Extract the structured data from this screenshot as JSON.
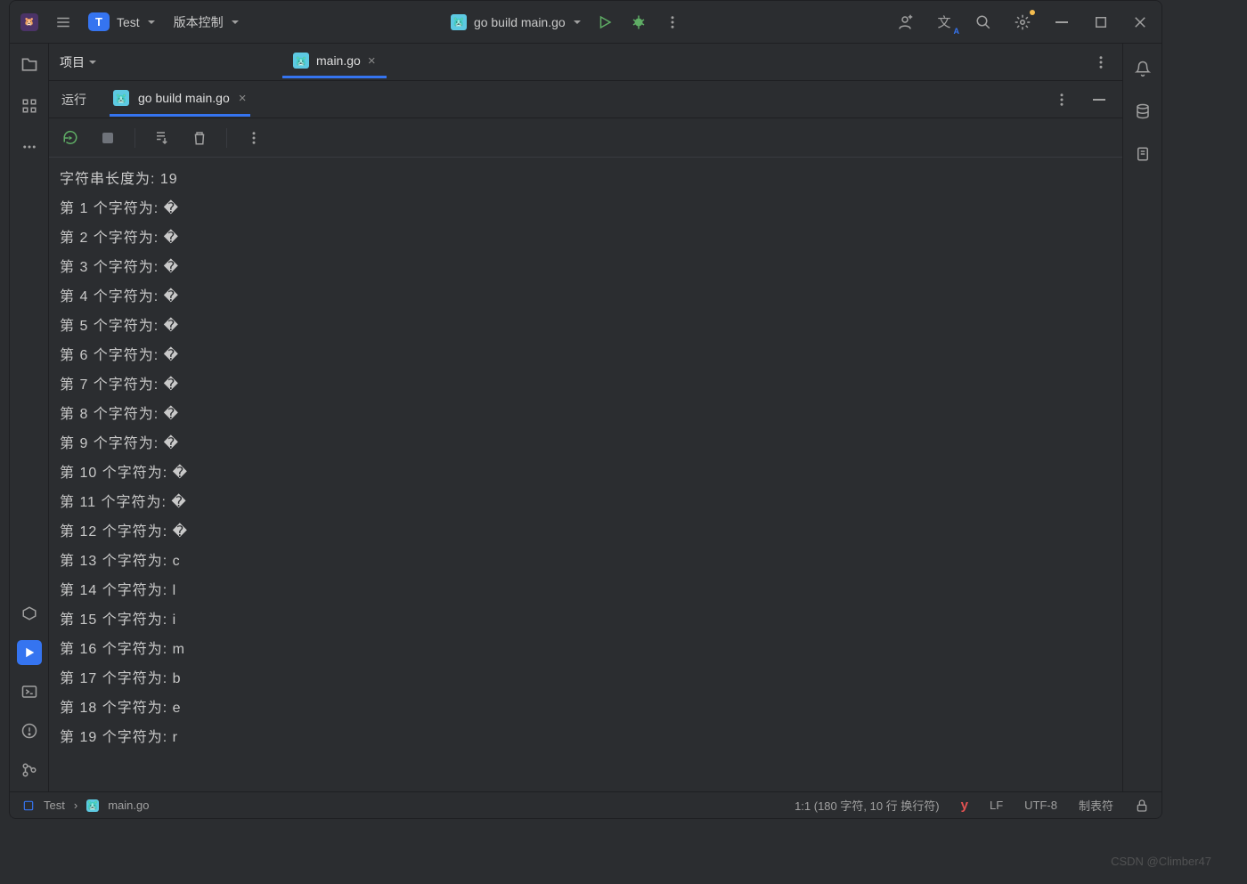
{
  "topbar": {
    "project_initial": "T",
    "project_name": "Test",
    "vcs_label": "版本控制",
    "run_config": "go build main.go"
  },
  "panel": {
    "title": "项目"
  },
  "editor_tab": {
    "file": "main.go"
  },
  "run_panel": {
    "run_label": "运行",
    "active_tab": "go build main.go"
  },
  "console_lines": [
    "字符串长度为: 19",
    "第 1 个字符为: �",
    "第 2 个字符为: �",
    "第 3 个字符为: �",
    "第 4 个字符为: �",
    "第 5 个字符为: �",
    "第 6 个字符为: �",
    "第 7 个字符为: �",
    "第 8 个字符为: �",
    "第 9 个字符为: �",
    "第 10 个字符为: �",
    "第 11 个字符为: �",
    "第 12 个字符为: �",
    "第 13 个字符为: c",
    "第 14 个字符为: l",
    "第 15 个字符为: i",
    "第 16 个字符为: m",
    "第 17 个字符为: b",
    "第 18 个字符为: e",
    "第 19 个字符为: r"
  ],
  "statusbar": {
    "project": "Test",
    "file": "main.go",
    "position": "1:1 (180 字符, 10 行 换行符)",
    "line_sep": "LF",
    "encoding": "UTF-8",
    "indent": "制表符"
  },
  "watermark": "CSDN @Climber47"
}
